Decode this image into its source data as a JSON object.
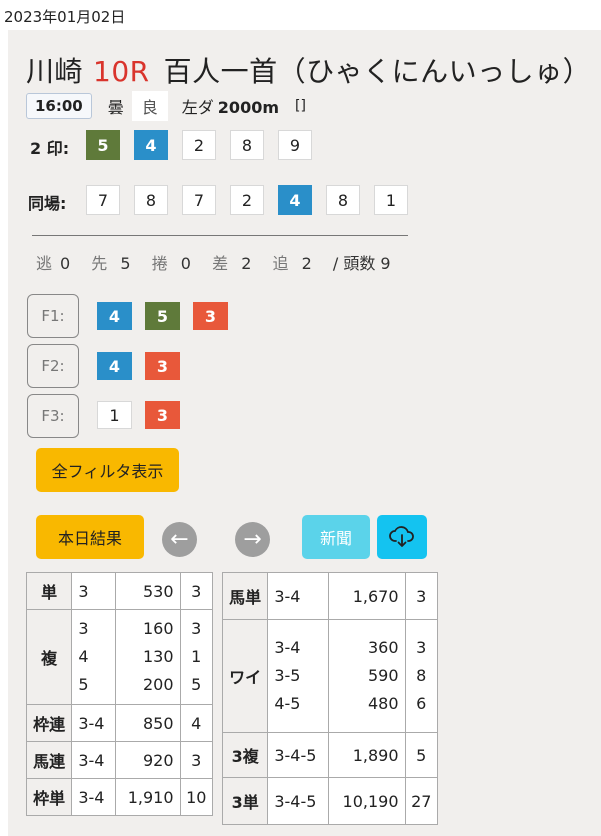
{
  "date": "2023年01月02日",
  "race": {
    "venue": "川崎",
    "number": "10R",
    "name": "百人一首（ひゃくにんいっしゅ）"
  },
  "info": {
    "time": "16:00",
    "weather": "曇",
    "going": "良",
    "course": "左ダ",
    "distance": "2000m",
    "extra": "[]"
  },
  "two_marks": {
    "label": "2 印:",
    "items": [
      "5",
      "4",
      "2",
      "8",
      "9"
    ]
  },
  "same_track": {
    "label": "同場:",
    "items": [
      "7",
      "8",
      "7",
      "2",
      "4",
      "8",
      "1"
    ]
  },
  "running_styles": {
    "nige_k": "逃",
    "nige_v": "0",
    "sen_k": "先",
    "sen_v": "5",
    "makuri_k": "捲",
    "makuri_v": "0",
    "sashi_k": "差",
    "sashi_v": "2",
    "oi_k": "追",
    "oi_v": "2",
    "count": "/ 頭数 9"
  },
  "filters": [
    {
      "label": "F1:",
      "items": [
        "4",
        "5",
        "3"
      ]
    },
    {
      "label": "F2:",
      "items": [
        "4",
        "3"
      ]
    },
    {
      "label": "F3:",
      "items": [
        "1",
        "3"
      ]
    }
  ],
  "buttons": {
    "show_all_filters": "全フィルタ表示",
    "today_results": "本日結果",
    "prev_icon": "←",
    "next_icon": "→",
    "newspaper": "新聞",
    "download_icon": "cloud-download"
  },
  "payouts_left": {
    "tan": {
      "label": "単",
      "combo": "3",
      "pay": "530",
      "pop": "3"
    },
    "fuku": {
      "label": "複",
      "combos": [
        "3",
        "4",
        "5"
      ],
      "pays": [
        "160",
        "130",
        "200"
      ],
      "pops": [
        "3",
        "1",
        "5"
      ]
    },
    "wakuren": {
      "label": "枠連",
      "combo": "3-4",
      "pay": "850",
      "pop": "4"
    },
    "umaren": {
      "label": "馬連",
      "combo": "3-4",
      "pay": "920",
      "pop": "3"
    },
    "wakutan": {
      "label": "枠単",
      "combo": "3-4",
      "pay": "1,910",
      "pop": "10"
    }
  },
  "payouts_right": {
    "umatan": {
      "label": "馬単",
      "combo": "3-4",
      "pay": "1,670",
      "pop": "3"
    },
    "wide": {
      "label": "ワイ",
      "combos": [
        "3-4",
        "3-5",
        "4-5"
      ],
      "pays": [
        "360",
        "590",
        "480"
      ],
      "pops": [
        "3",
        "8",
        "6"
      ]
    },
    "sanfuku": {
      "label": "3複",
      "combo": "3-4-5",
      "pay": "1,890",
      "pop": "5"
    },
    "santan": {
      "label": "3単",
      "combo": "3-4-5",
      "pay": "10,190",
      "pop": "27"
    }
  },
  "colors": {
    "green": "#5f7a3a",
    "blue": "#2a8fc9",
    "red": "#e8583a",
    "yellow": "#f9b800",
    "race_number": "#d9342c"
  }
}
